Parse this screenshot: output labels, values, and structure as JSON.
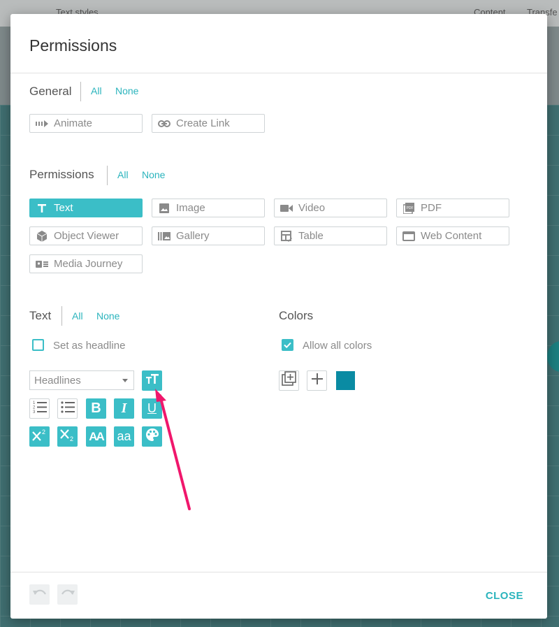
{
  "background": {
    "tabs": [
      "Text styles",
      "Content",
      "Transfe"
    ]
  },
  "dialog": {
    "title": "Permissions",
    "general": {
      "title": "General",
      "all": "All",
      "none": "None",
      "items": [
        {
          "label": "Animate",
          "icon": "animate-icon",
          "active": false
        },
        {
          "label": "Create Link",
          "icon": "link-icon",
          "active": false
        }
      ]
    },
    "permissions": {
      "title": "Permissions",
      "all": "All",
      "none": "None",
      "items": [
        {
          "label": "Text",
          "icon": "text-icon",
          "active": true
        },
        {
          "label": "Image",
          "icon": "image-icon",
          "active": false
        },
        {
          "label": "Video",
          "icon": "video-icon",
          "active": false
        },
        {
          "label": "PDF",
          "icon": "pdf-icon",
          "active": false
        },
        {
          "label": "Object Viewer",
          "icon": "cube-icon",
          "active": false
        },
        {
          "label": "Gallery",
          "icon": "gallery-icon",
          "active": false
        },
        {
          "label": "Table",
          "icon": "table-icon",
          "active": false
        },
        {
          "label": "Web Content",
          "icon": "web-icon",
          "active": false
        },
        {
          "label": "Media Journey",
          "icon": "media-journey-icon",
          "active": false
        }
      ]
    },
    "text": {
      "title": "Text",
      "all": "All",
      "none": "None",
      "set_as_headline": "Set as headline",
      "set_as_headline_checked": false,
      "headlines_select": "Headlines"
    },
    "colors": {
      "title": "Colors",
      "allow_all": "Allow all colors",
      "allow_all_checked": true,
      "swatch_color": "#0a8ba3"
    },
    "footer": {
      "close": "CLOSE"
    },
    "accent_color": "#3bbec7",
    "annotation_color": "#f0176c"
  }
}
